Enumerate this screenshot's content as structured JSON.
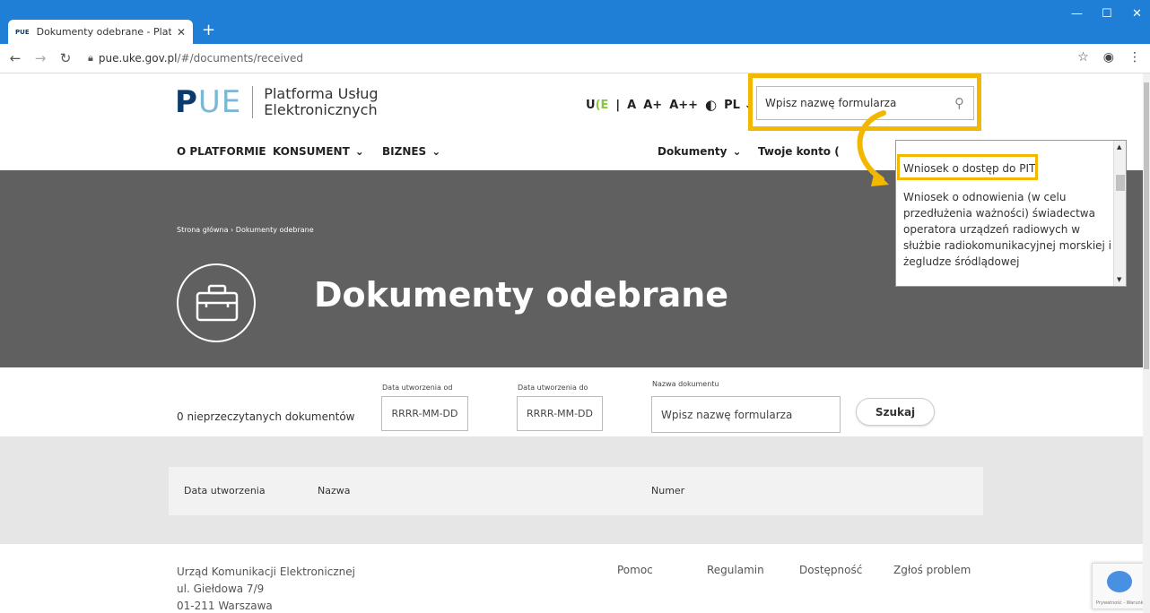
{
  "browser": {
    "tab_favicon": "PUE",
    "tab_title": "Dokumenty odebrane - Platforma",
    "tab_close": "✕",
    "new_tab": "+",
    "url_host": "pue.uke.gov.pl",
    "url_path": "/#/documents/received"
  },
  "header": {
    "logo_p": "P",
    "logo_ue": "UE",
    "logo_line1": "Platforma Usług",
    "logo_line2": "Elektronicznych",
    "tools": {
      "uke_u": "U",
      "uke_k": "(",
      "uke_e": "E",
      "sep": "|",
      "font_a": "A",
      "font_a_plus": "A+",
      "font_a_plus_plus": "A++",
      "contrast": "◐",
      "lang": "PL"
    },
    "search_placeholder": "Wpisz nazwę formularza",
    "nav": {
      "o_platformie": "O PLATFORMIE",
      "konsument": "KONSUMENT",
      "biznes": "BIZNES",
      "dokumenty": "Dokumenty",
      "twoje_konto": "Twoje konto ("
    }
  },
  "dropdown": {
    "items": [
      "Wniosek o dostęp do PIT",
      "Wniosek o odnowienia (w celu przedłużenia ważności) świadectwa operatora urządzeń radiowych w służbie radiokomunikacyjnej morskiej i żegludze śródlądowej"
    ]
  },
  "hero": {
    "breadcrumb_home": "Strona główna",
    "breadcrumb_sep": "›",
    "breadcrumb_current": "Dokumenty odebrane",
    "title": "Dokumenty odebrane"
  },
  "filters": {
    "unread": "0 nieprzeczytanych dokumentów",
    "date_from_label": "Data utworzenia od",
    "date_from_placeholder": "RRRR-MM-DD",
    "date_to_label": "Data utworzenia do",
    "date_to_placeholder": "RRRR-MM-DD",
    "name_label": "Nazwa dokumentu",
    "name_placeholder": "Wpisz nazwę formularza",
    "search_button": "Szukaj"
  },
  "table": {
    "headers": [
      "Data utworzenia",
      "Nazwa",
      "Numer"
    ]
  },
  "footer": {
    "address": [
      "Urząd Komunikacji Elektronicznej",
      "ul. Giełdowa 7/9",
      "01-211 Warszawa"
    ],
    "links": [
      "Pomoc",
      "Regulamin",
      "Dostępność",
      "Zgłoś problem"
    ]
  },
  "recaptcha_text": "Prywatność - Warunki",
  "colors": {
    "tabbar": "#1f7fd6",
    "highlight": "#f2b800",
    "hero": "#606060",
    "logo_dark": "#0a3c6e",
    "logo_light": "#7bb8d4",
    "uke_green": "#8cc63f"
  }
}
